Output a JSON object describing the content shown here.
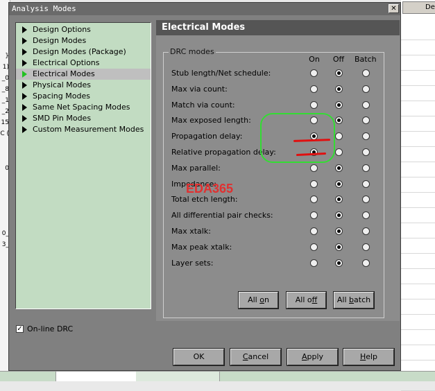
{
  "dialog": {
    "title": "Analysis Modes",
    "close_glyph": "✕"
  },
  "tree": {
    "items": [
      {
        "label": "Design Options",
        "selected": false
      },
      {
        "label": "Design Modes",
        "selected": false
      },
      {
        "label": "Design Modes (Package)",
        "selected": false
      },
      {
        "label": "Electrical Options",
        "selected": false
      },
      {
        "label": "Electrical Modes",
        "selected": true
      },
      {
        "label": "Physical Modes",
        "selected": false
      },
      {
        "label": "Spacing Modes",
        "selected": false
      },
      {
        "label": "Same Net Spacing Modes",
        "selected": false
      },
      {
        "label": "SMD Pin Modes",
        "selected": false
      },
      {
        "label": "Custom Measurement Modes",
        "selected": false
      }
    ]
  },
  "online_drc": {
    "label": "On-line DRC",
    "checked": true,
    "mark": "✓"
  },
  "panel": {
    "title": "Electrical Modes",
    "group_title": "DRC modes",
    "columns": [
      "On",
      "Off",
      "Batch"
    ],
    "rows": [
      {
        "label": "Stub length/Net schedule:",
        "selected": "Off"
      },
      {
        "label": "Max via count:",
        "selected": "Off"
      },
      {
        "label": "Match via count:",
        "selected": "Off"
      },
      {
        "label": "Max exposed length:",
        "selected": "Off"
      },
      {
        "label": "Propagation delay:",
        "selected": "On"
      },
      {
        "label": "Relative propagation delay:",
        "selected": "On"
      },
      {
        "label": "Max parallel:",
        "selected": "Off"
      },
      {
        "label": "Impedance:",
        "selected": "Off"
      },
      {
        "label": "Total etch length:",
        "selected": "Off"
      },
      {
        "label": "All differential pair checks:",
        "selected": "Off"
      },
      {
        "label": "Max xtalk:",
        "selected": "Off"
      },
      {
        "label": "Max peak xtalk:",
        "selected": "Off"
      },
      {
        "label": "Layer sets:",
        "selected": "Off"
      }
    ],
    "buttons": {
      "all_on": {
        "pre": "All ",
        "ul": "o",
        "post": "n"
      },
      "all_off": {
        "pre": "All o",
        "ul": "f",
        "post": "f"
      },
      "all_batch": {
        "pre": "All ",
        "ul": "b",
        "post": "atch"
      }
    }
  },
  "footer_buttons": {
    "ok": {
      "pre": "",
      "ul": "",
      "post": "OK"
    },
    "cancel": {
      "pre": "",
      "ul": "C",
      "post": "ancel"
    },
    "apply": {
      "pre": "",
      "ul": "A",
      "post": "pply"
    },
    "help": {
      "pre": "",
      "ul": "H",
      "post": "elp"
    }
  },
  "watermark": "EDA365",
  "background": {
    "left_cells": [
      "}",
      "1)",
      "_0",
      "_8",
      "_1",
      "_2",
      "15",
      "C (",
      "0",
      "0_",
      "3_"
    ],
    "right_button": "De"
  },
  "colors": {
    "tree_bg": "#c2dcc2",
    "annotation_circle": "#33dd33",
    "annotation_line": "#e01010",
    "watermark": "#e03030",
    "selected_arrow": "#21c221"
  }
}
